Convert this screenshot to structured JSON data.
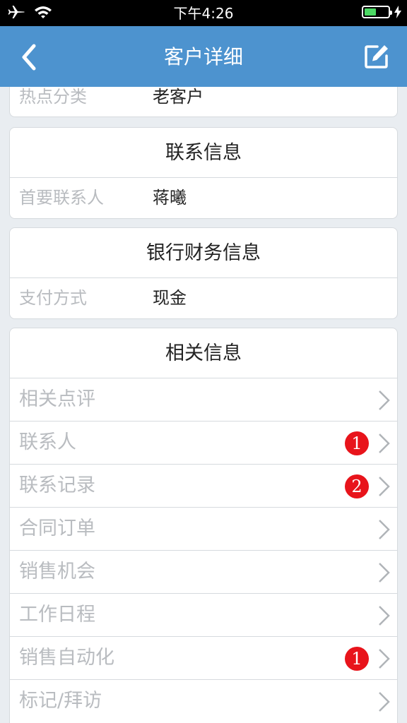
{
  "status_bar": {
    "time": "下午4:26",
    "icons": [
      "airplane-icon",
      "wifi-icon",
      "battery-icon",
      "charging-bolt-icon"
    ]
  },
  "nav": {
    "title": "客户详细",
    "back_icon": "chevron-left-icon",
    "edit_icon": "edit-icon"
  },
  "partial_card": {
    "label": "热点分类",
    "value": "老客户"
  },
  "contact_card": {
    "header": "联系信息",
    "label": "首要联系人",
    "value": "蒋曦"
  },
  "bank_card": {
    "header": "银行财务信息",
    "label": "支付方式",
    "value": "现金"
  },
  "related_card": {
    "header": "相关信息",
    "items": [
      {
        "label": "相关点评",
        "badge": ""
      },
      {
        "label": "联系人",
        "badge": "1"
      },
      {
        "label": "联系记录",
        "badge": "2"
      },
      {
        "label": "合同订单",
        "badge": ""
      },
      {
        "label": "销售机会",
        "badge": ""
      },
      {
        "label": "工作日程",
        "badge": ""
      },
      {
        "label": "销售自动化",
        "badge": "1"
      },
      {
        "label": "标记/拜访",
        "badge": ""
      }
    ]
  },
  "colors": {
    "nav_background": "#4d93cf",
    "page_background": "#e9edf1",
    "badge": "#e8141b",
    "label_gray": "#b9bcc0"
  }
}
